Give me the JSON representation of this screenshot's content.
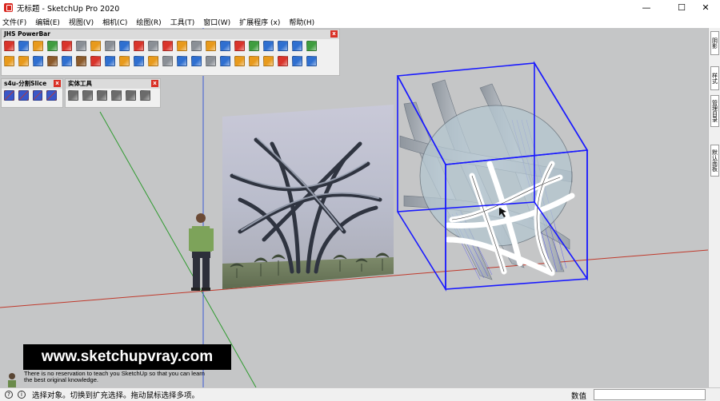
{
  "app": {
    "title": "无标题 - SketchUp Pro 2020"
  },
  "window_controls": {
    "minimize": "—",
    "maximize": "☐",
    "close": "✕"
  },
  "menubar": {
    "items": [
      "文件(F)",
      "编辑(E)",
      "视图(V)",
      "相机(C)",
      "绘图(R)",
      "工具(T)",
      "窗口(W)",
      "扩展程序 (x)",
      "帮助(H)"
    ]
  },
  "toolbars": {
    "powerbar": {
      "title": "JHS PowerBar",
      "row1_icons": [
        "red-box-icon",
        "blue-box-icon",
        "orange-box-icon",
        "green-box-icon",
        "red-face-icon",
        "grey-face-icon",
        "orange-cog-icon",
        "grey-cog-icon",
        "blue-surface-icon",
        "red-square-icon",
        "grey-square-icon",
        "red-flag-icon",
        "orange-cubes-icon",
        "grey-link-icon",
        "orange-chain-icon",
        "blue-chain-icon",
        "red-cross-icon",
        "green-cross-icon",
        "blue-cross-icon",
        "blue-grid-icon",
        "blue-cone-icon",
        "green-cone-icon"
      ],
      "row2_icons": [
        "orange-triangle-icon",
        "orange-rotate-icon",
        "blue-rotate-icon",
        "brown-bucket-icon",
        "blue-move-icon",
        "brown-can-icon",
        "red-magnet-icon",
        "blue-swap-icon",
        "orange-mesh-icon",
        "blue-mesh-icon",
        "orange-gear-icon",
        "grey-square2-icon",
        "blue-grid2-icon",
        "blue-grid3-icon",
        "grey-grid-icon",
        "blue-grid4-icon",
        "orange-tile-icon",
        "orange-tile2-icon",
        "orange-tile3-icon",
        "red-dots-icon",
        "blue-pen-icon",
        "blue-target-icon"
      ]
    },
    "slice": {
      "title": "s4u-分割Slice",
      "icons": [
        "slice-icon-1",
        "slice-icon-2",
        "slice-icon-3",
        "slice-icon-4"
      ]
    },
    "solid_tools": {
      "title": "实体工具",
      "icons": [
        "outer-shell-icon",
        "intersect-icon",
        "union-icon",
        "subtract-icon",
        "trim-icon",
        "split-icon"
      ]
    },
    "close_glyph": "x"
  },
  "right_tray": {
    "tabs": [
      "阴影",
      "样式",
      "管理目录",
      "默认面板"
    ]
  },
  "watermark": {
    "url": "www.sketchupvray.com",
    "note_line1": "There is no reservation to teach you SketchUp so that you can learn",
    "note_line2": "the best original knowledge."
  },
  "statusbar": {
    "icon1": "?",
    "icon2": "i",
    "status_text": "选择对象。切换到扩充选择。拖动鼠标选择多项。",
    "measure_label": "数值",
    "measure_value": ""
  },
  "colors": {
    "viewport_bg": "#c5c6c7",
    "selection_blue": "#1a1aff",
    "axis_red": "#c0392b",
    "axis_green": "#2e9a2e",
    "axis_blue": "#3b5bd6"
  }
}
